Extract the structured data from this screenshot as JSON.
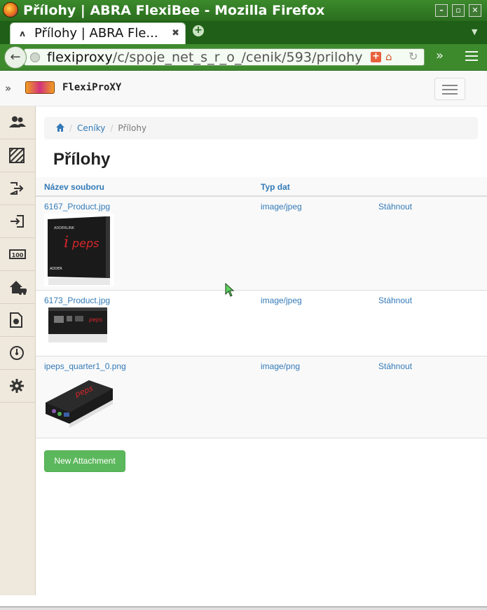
{
  "window": {
    "title": "Přílohy | ABRA FlexiBee - Mozilla Firefox",
    "controls": [
      "minimize",
      "maximize",
      "close"
    ]
  },
  "browser": {
    "tab_title": "Přílohy | ABRA Fle...",
    "url_host": "flexiproxy",
    "url_path": "/c/spoje_net_s_r_o_/cenik/593/prilohy"
  },
  "app": {
    "brand": "FlexiProXY",
    "sidebar_icons": [
      "users-icon",
      "pattern-icon",
      "logout-icon",
      "login-icon",
      "banknote-icon",
      "house-car-icon",
      "document-chart-icon",
      "gauge-icon",
      "gear-icon"
    ]
  },
  "breadcrumb": {
    "items": [
      "Ceníky",
      "Přílohy"
    ]
  },
  "page": {
    "title": "Přílohy"
  },
  "table": {
    "headers": [
      "Název souboru",
      "Typ dat",
      ""
    ],
    "rows": [
      {
        "filename": "6167_Product.jpg",
        "type": "image/jpeg",
        "action": "Stáhnout"
      },
      {
        "filename": "6173_Product.jpg",
        "type": "image/jpeg",
        "action": "Stáhnout"
      },
      {
        "filename": "ipeps_quarter1_0.png",
        "type": "image/png",
        "action": "Stáhnout"
      }
    ]
  },
  "actions": {
    "new_attachment": "New Attachment"
  },
  "colors": {
    "link": "#337ab7",
    "button_success": "#5cb85c",
    "firefox_green": "#3d8a2d"
  }
}
